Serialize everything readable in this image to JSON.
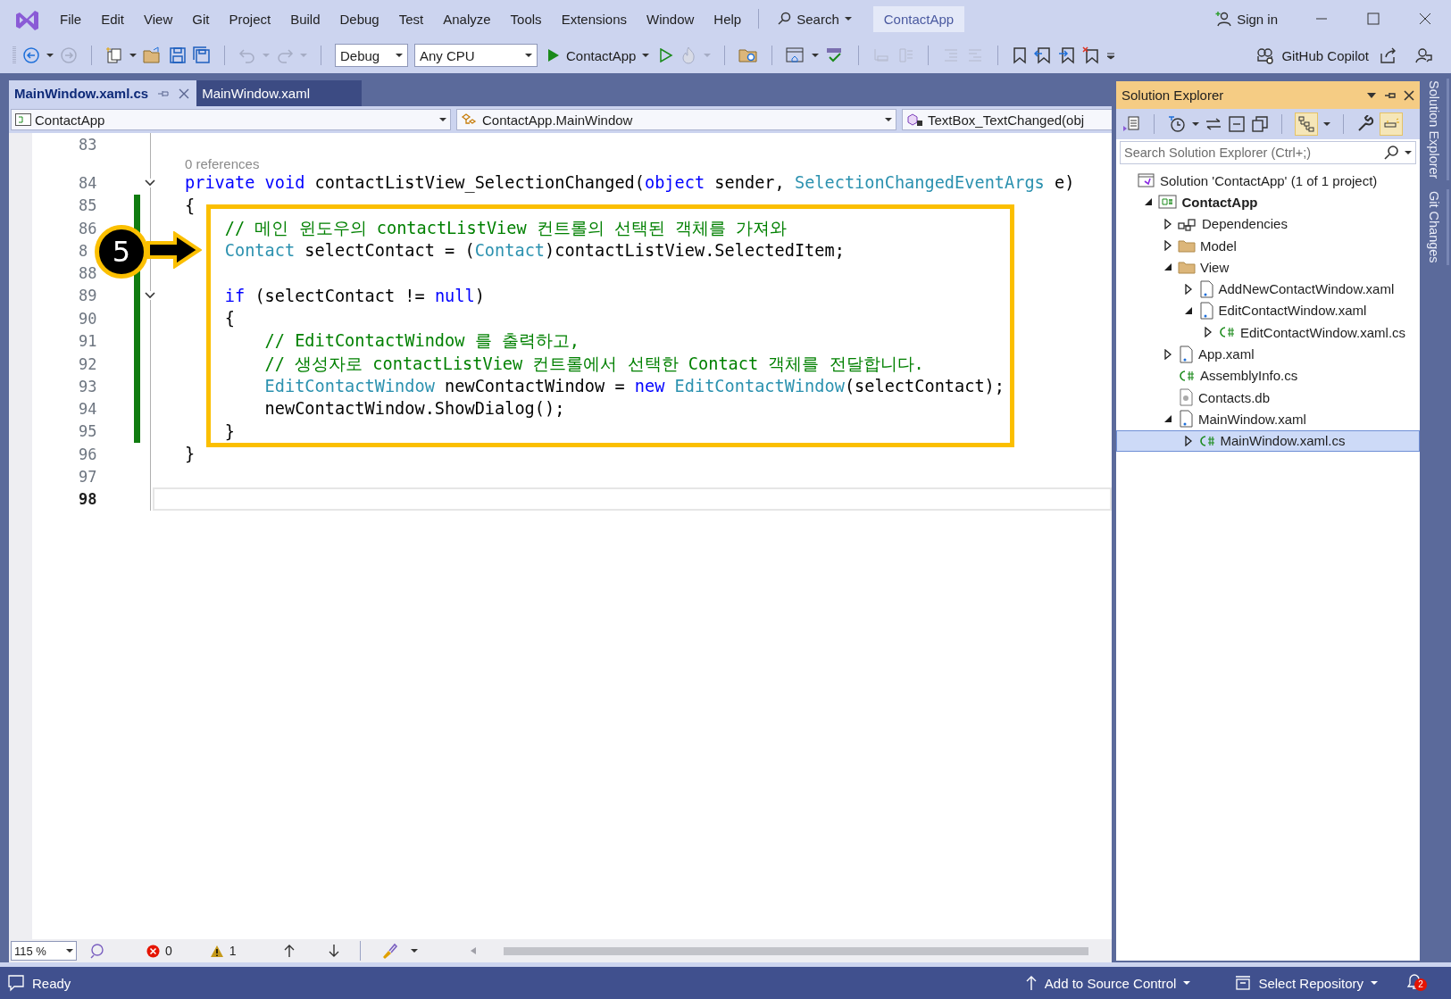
{
  "title_bar": {
    "menu": [
      "File",
      "Edit",
      "View",
      "Git",
      "Project",
      "Build",
      "Debug",
      "Test",
      "Analyze",
      "Tools",
      "Extensions",
      "Window",
      "Help"
    ],
    "search": "Search",
    "solution_name": "ContactApp",
    "sign_in": "Sign in"
  },
  "toolbar": {
    "configuration": "Debug",
    "platform": "Any CPU",
    "start": "ContactApp",
    "copilot": "GitHub Copilot"
  },
  "editor": {
    "tabs": [
      {
        "label": "MainWindow.xaml.cs",
        "selected": true
      },
      {
        "label": "MainWindow.xaml",
        "selected": false
      }
    ],
    "nav": [
      "ContactApp",
      "ContactApp.MainWindow",
      "TextBox_TextChanged(obj"
    ],
    "lines": [
      {
        "number": "83",
        "fold": false,
        "changed": false,
        "current": false
      },
      {
        "number": "84",
        "fold": true,
        "changed": false,
        "current": false,
        "lens": "0 references",
        "tokens": [
          {
            "kind": "keyword",
            "text": "private"
          },
          {
            "kind": "keyword",
            "text": " void"
          },
          {
            "kind": "plain",
            "text": " contactListView_SelectionChanged("
          },
          {
            "kind": "keyword",
            "text": "object"
          },
          {
            "kind": "plain",
            "text": " sender,"
          },
          {
            "kind": "type",
            "text": " SelectionChangedEventArgs"
          },
          {
            "kind": "plain",
            "text": " e)"
          }
        ]
      },
      {
        "number": "85",
        "fold": false,
        "changed": true,
        "current": false,
        "tokens": [
          {
            "kind": "plain",
            "text": "{"
          }
        ]
      },
      {
        "number": "86",
        "fold": false,
        "changed": true,
        "current": false,
        "tokens": [
          {
            "kind": "comment",
            "text": "    // 메인 윈도우의 contactListView 컨트롤의 선택된 객체를 가져와"
          }
        ]
      },
      {
        "number": "8",
        "fold": false,
        "current": false,
        "tokens": [
          {
            "kind": "type",
            "text": "    Contact"
          },
          {
            "kind": "plain",
            "text": " selectContact = ("
          },
          {
            "kind": "type",
            "text": "Contact"
          },
          {
            "kind": "plain",
            "text": ")contactListView.SelectedItem;"
          }
        ]
      },
      {
        "number": "88",
        "fold": false,
        "changed": true,
        "current": false
      },
      {
        "number": "89",
        "fold": true,
        "changed": true,
        "current": false,
        "tokens": [
          {
            "kind": "keyword",
            "text": "    if"
          },
          {
            "kind": "plain",
            "text": " (selectContact != "
          },
          {
            "kind": "keyword",
            "text": "null"
          },
          {
            "kind": "plain",
            "text": ")"
          }
        ]
      },
      {
        "number": "90",
        "fold": false,
        "changed": true,
        "current": false,
        "tokens": [
          {
            "kind": "plain",
            "text": "    {"
          }
        ]
      },
      {
        "number": "91",
        "fold": false,
        "changed": true,
        "current": false,
        "tokens": [
          {
            "kind": "comment",
            "text": "        // EditContactWindow 를 출력하고,"
          }
        ]
      },
      {
        "number": "92",
        "fold": false,
        "changed": true,
        "current": false,
        "tokens": [
          {
            "kind": "comment",
            "text": "        // 생성자로 contactListView 컨트롤에서 선택한 Contact 객체를 전달합니다."
          }
        ]
      },
      {
        "number": "93",
        "fold": false,
        "changed": true,
        "current": false,
        "tokens": [
          {
            "kind": "type",
            "text": "        EditContactWindow"
          },
          {
            "kind": "plain",
            "text": " newContactWindow = "
          },
          {
            "kind": "keyword",
            "text": "new"
          },
          {
            "kind": "type",
            "text": " EditContactWindow"
          },
          {
            "kind": "plain",
            "text": "(selectContact);"
          }
        ]
      },
      {
        "number": "94",
        "fold": false,
        "changed": true,
        "current": false,
        "tokens": [
          {
            "kind": "plain",
            "text": "        newContactWindow.ShowDialog();"
          }
        ]
      },
      {
        "number": "95",
        "fold": false,
        "changed": true,
        "current": false,
        "tokens": [
          {
            "kind": "plain",
            "text": "    }"
          }
        ]
      },
      {
        "number": "96",
        "fold": false,
        "changed": false,
        "current": false,
        "tokens": [
          {
            "kind": "plain",
            "text": "}"
          }
        ]
      },
      {
        "number": "97",
        "fold": false,
        "changed": false,
        "current": false
      },
      {
        "number": "98",
        "fold": false,
        "changed": false,
        "current": true
      }
    ],
    "annotation": {
      "badge": "5"
    },
    "zoom": "115 %",
    "errors": "0",
    "warnings": "1"
  },
  "solution_explorer": {
    "title": "Solution Explorer",
    "search": {
      "placeholder": "Search Solution Explorer (Ctrl+;)"
    },
    "tree": [
      {
        "label": "Solution 'ContactApp' (1 of 1 project)",
        "kind": "solution",
        "selected": false,
        "children": [
          {
            "label": "ContactApp",
            "kind": "project",
            "expanded": true,
            "selected": false,
            "children": [
              {
                "label": "Dependencies",
                "kind": "dependencies",
                "expanded": false,
                "selected": false
              },
              {
                "label": "Model",
                "kind": "folder",
                "expanded": false,
                "selected": false
              },
              {
                "label": "View",
                "kind": "folder",
                "expanded": true,
                "selected": false,
                "children": [
                  {
                    "label": "AddNewContactWindow.xaml",
                    "kind": "xaml",
                    "expanded": false,
                    "selected": false
                  },
                  {
                    "label": "EditContactWindow.xaml",
                    "kind": "xaml",
                    "expanded": true,
                    "selected": false,
                    "children": [
                      {
                        "label": "EditContactWindow.xaml.cs",
                        "kind": "csharp",
                        "expanded": false,
                        "selected": false
                      }
                    ]
                  }
                ]
              },
              {
                "label": "App.xaml",
                "kind": "xaml",
                "expanded": false,
                "selected": false
              },
              {
                "label": "AssemblyInfo.cs",
                "kind": "csharp",
                "selected": false
              },
              {
                "label": "Contacts.db",
                "kind": "database",
                "selected": false
              },
              {
                "label": "MainWindow.xaml",
                "kind": "xaml",
                "expanded": true,
                "selected": false,
                "children": [
                  {
                    "label": "MainWindow.xaml.cs",
                    "kind": "csharp",
                    "expanded": false,
                    "selected": true
                  }
                ]
              }
            ]
          }
        ]
      }
    ]
  },
  "side_tabs": [
    "Solution Explorer",
    "Git Changes"
  ],
  "status_bar": {
    "state": "Ready",
    "source_control": "Add to Source Control",
    "repository": "Select Repository",
    "notifications": "2"
  }
}
